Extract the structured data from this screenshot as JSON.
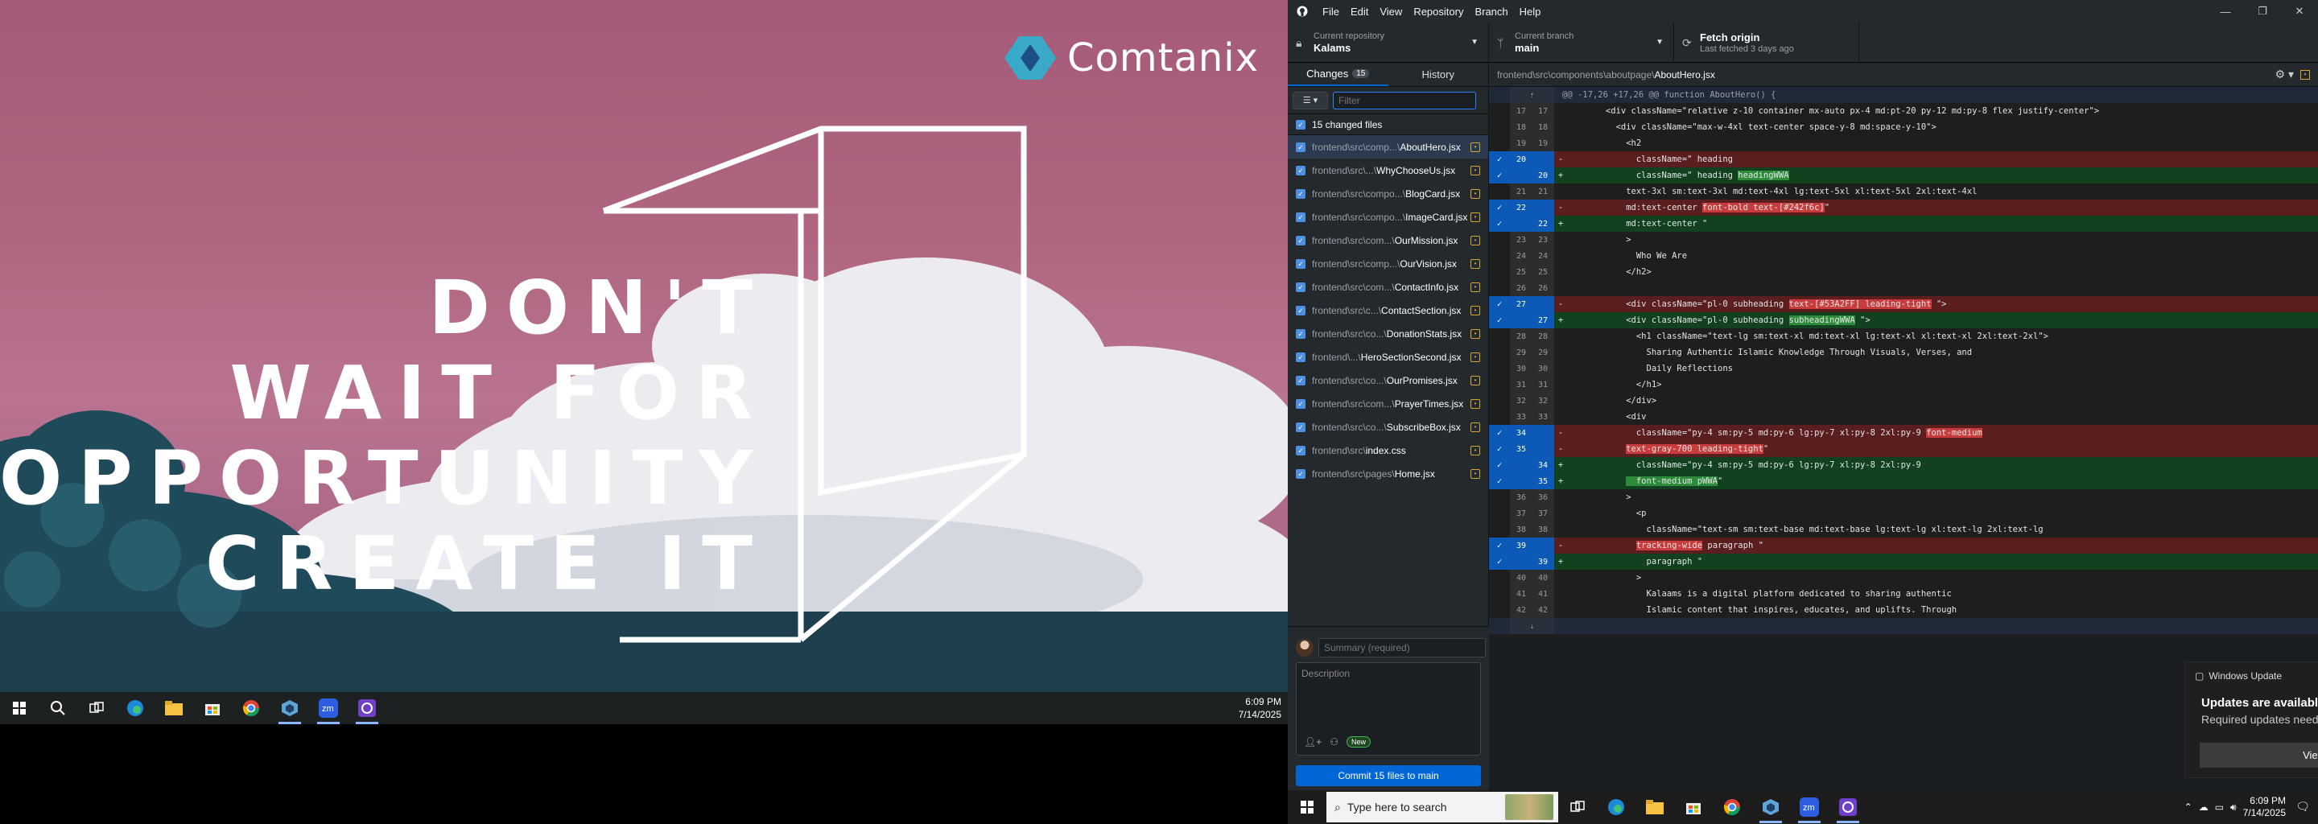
{
  "left_desktop": {
    "brand": "Comtanix",
    "poster_lines": [
      "DON'T",
      "WAIT FOR",
      "OPPORTUNITY",
      "CREATE IT"
    ],
    "taskbar_clock_time": "6:09 PM",
    "taskbar_clock_date": "7/14/2025"
  },
  "app": {
    "menu": [
      "File",
      "Edit",
      "View",
      "Repository",
      "Branch",
      "Help"
    ],
    "toolbar": {
      "repo_label": "Current repository",
      "repo_value": "Kalams",
      "branch_label": "Current branch",
      "branch_value": "main",
      "fetch_label": "Fetch origin",
      "fetch_sub": "Last fetched 3 days ago"
    },
    "tabs": {
      "changes": "Changes",
      "changes_count": "15",
      "history": "History"
    },
    "filter_placeholder": "Filter",
    "changed_files_label": "15 changed files",
    "files": [
      {
        "path": "frontend\\src\\comp...\\",
        "name": "AboutHero.jsx"
      },
      {
        "path": "frontend\\src\\...\\",
        "name": "WhyChooseUs.jsx"
      },
      {
        "path": "frontend\\src\\compo...\\",
        "name": "BlogCard.jsx"
      },
      {
        "path": "frontend\\src\\compo...\\",
        "name": "ImageCard.jsx"
      },
      {
        "path": "frontend\\src\\com...\\",
        "name": "OurMission.jsx"
      },
      {
        "path": "frontend\\src\\comp...\\",
        "name": "OurVision.jsx"
      },
      {
        "path": "frontend\\src\\com...\\",
        "name": "ContactInfo.jsx"
      },
      {
        "path": "frontend\\src\\c...\\",
        "name": "ContactSection.jsx"
      },
      {
        "path": "frontend\\src\\co...\\",
        "name": "DonationStats.jsx"
      },
      {
        "path": "frontend\\...\\",
        "name": "HeroSectionSecond.jsx"
      },
      {
        "path": "frontend\\src\\co...\\",
        "name": "OurPromises.jsx"
      },
      {
        "path": "frontend\\src\\com...\\",
        "name": "PrayerTimes.jsx"
      },
      {
        "path": "frontend\\src\\co...\\",
        "name": "SubscribeBox.jsx"
      },
      {
        "path": "frontend\\src\\",
        "name": "index.css"
      },
      {
        "path": "frontend\\src\\pages\\",
        "name": "Home.jsx"
      }
    ],
    "summary_placeholder": "Summary (required)",
    "description_placeholder": "Description",
    "new_badge": "New",
    "commit_button": "Commit 15 files to main",
    "diff_path": "frontend\\src\\components\\aboutpage\\",
    "diff_file": "AboutHero.jsx",
    "hunk_header": "@@ -17,26 +17,26 @@ function AboutHero() {",
    "diff_lines": [
      {
        "t": "ctx",
        "o": "17",
        "n": "17",
        "c": "      <div className=\"relative z-10 container mx-auto px-4 md:pt-20 py-12 md:py-8 flex justify-center\">"
      },
      {
        "t": "ctx",
        "o": "18",
        "n": "18",
        "c": "        <div className=\"max-w-4xl text-center space-y-8 md:space-y-10\">"
      },
      {
        "t": "ctx",
        "o": "19",
        "n": "19",
        "c": "          <h2"
      },
      {
        "t": "del",
        "o": "20",
        "n": "",
        "c": "            className=\" heading",
        "hl": ""
      },
      {
        "t": "add",
        "o": "",
        "n": "20",
        "c": "            className=\" heading ",
        "hl": "headingWWA"
      },
      {
        "t": "ctx",
        "o": "21",
        "n": "21",
        "c": "          text-3xl sm:text-3xl md:text-4xl lg:text-5xl xl:text-5xl 2xl:text-4xl"
      },
      {
        "t": "del",
        "o": "22",
        "n": "",
        "c": "          md:text-center ",
        "hl": "font-bold text-[#242f6c]",
        "after": "\""
      },
      {
        "t": "add",
        "o": "",
        "n": "22",
        "c": "          md:text-center \"",
        "hl": ""
      },
      {
        "t": "ctx",
        "o": "23",
        "n": "23",
        "c": "          >"
      },
      {
        "t": "ctx",
        "o": "24",
        "n": "24",
        "c": "            Who We Are"
      },
      {
        "t": "ctx",
        "o": "25",
        "n": "25",
        "c": "          </h2>"
      },
      {
        "t": "ctx",
        "o": "26",
        "n": "26",
        "c": ""
      },
      {
        "t": "del",
        "o": "27",
        "n": "",
        "c": "          <div className=\"pl-0 subheading ",
        "hl": "text-[#53A2FF] leading-tight",
        "after": " \">"
      },
      {
        "t": "add",
        "o": "",
        "n": "27",
        "c": "          <div className=\"pl-0 subheading ",
        "hl": "subheadingWWA",
        "after": " \">"
      },
      {
        "t": "ctx",
        "o": "28",
        "n": "28",
        "c": "            <h1 className=\"text-lg sm:text-xl md:text-xl lg:text-xl xl:text-xl 2xl:text-2xl\">"
      },
      {
        "t": "ctx",
        "o": "29",
        "n": "29",
        "c": "              Sharing Authentic Islamic Knowledge Through Visuals, Verses, and"
      },
      {
        "t": "ctx",
        "o": "30",
        "n": "30",
        "c": "              Daily Reflections"
      },
      {
        "t": "ctx",
        "o": "31",
        "n": "31",
        "c": "            </h1>"
      },
      {
        "t": "ctx",
        "o": "32",
        "n": "32",
        "c": "          </div>"
      },
      {
        "t": "ctx",
        "o": "33",
        "n": "33",
        "c": "          <div"
      },
      {
        "t": "del",
        "o": "34",
        "n": "",
        "c": "            className=\"py-4 sm:py-5 md:py-6 lg:py-7 xl:py-8 2xl:py-9 ",
        "hl": "font-medium"
      },
      {
        "t": "del",
        "o": "35",
        "n": "",
        "c": "          ",
        "hl": "text-gray-700 leading-tight",
        "after": "\""
      },
      {
        "t": "add",
        "o": "",
        "n": "34",
        "c": "            className=\"py-4 sm:py-5 md:py-6 lg:py-7 xl:py-8 2xl:py-9",
        "hl": ""
      },
      {
        "t": "add",
        "o": "",
        "n": "35",
        "c": "          ",
        "hl": "  font-medium pWWA",
        "after": "\""
      },
      {
        "t": "ctx",
        "o": "36",
        "n": "36",
        "c": "          >"
      },
      {
        "t": "ctx",
        "o": "37",
        "n": "37",
        "c": "            <p"
      },
      {
        "t": "ctx",
        "o": "38",
        "n": "38",
        "c": "              className=\"text-sm sm:text-base md:text-base lg:text-lg xl:text-lg 2xl:text-lg"
      },
      {
        "t": "del",
        "o": "39",
        "n": "",
        "c": "            ",
        "hl": "tracking-wide",
        "after": " paragraph \""
      },
      {
        "t": "add",
        "o": "",
        "n": "39",
        "c": "              paragraph \"",
        "hl": ""
      },
      {
        "t": "ctx",
        "o": "40",
        "n": "40",
        "c": "            >"
      },
      {
        "t": "ctx",
        "o": "41",
        "n": "41",
        "c": "              Kalaams is a digital platform dedicated to sharing authentic"
      },
      {
        "t": "ctx",
        "o": "42",
        "n": "42",
        "c": "              Islamic content that inspires, educates, and uplifts. Through"
      }
    ]
  },
  "notification": {
    "app": "Windows Update",
    "title": "Updates are available",
    "body": "Required updates need to be downloaded.",
    "button": "View updates"
  },
  "right_taskbar": {
    "search_placeholder": "Type here to search",
    "clock_time": "6:09 PM",
    "clock_date": "7/14/2025"
  },
  "colors": {
    "accent": "#0366d6",
    "diff_del": "#5a1e1e",
    "diff_add": "#11411f"
  }
}
